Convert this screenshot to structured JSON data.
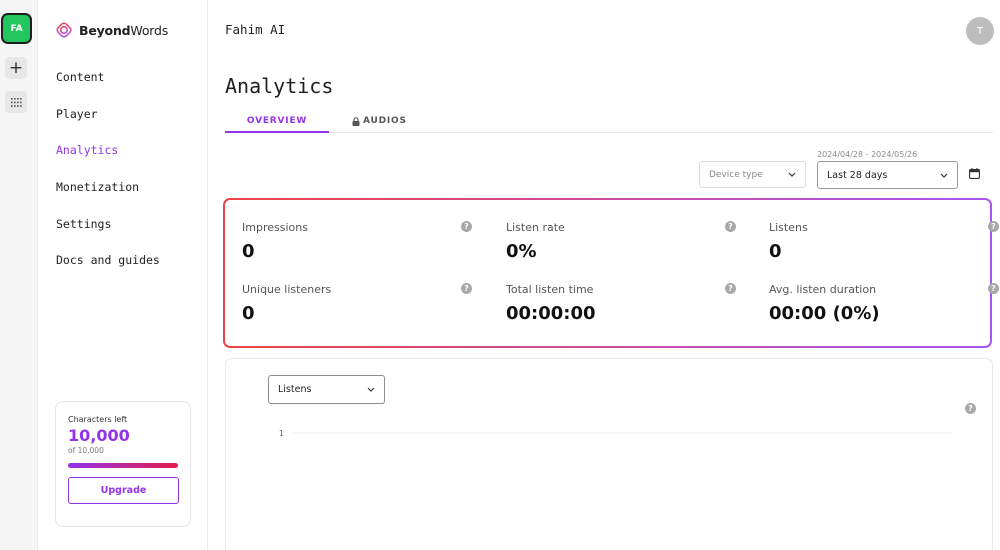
{
  "rail": {
    "workspace_badge": "FA",
    "icons": [
      "plus-icon",
      "grid-icon"
    ]
  },
  "sidebar": {
    "logo": {
      "bold": "Beyond",
      "regular": "Words",
      "icon": "beyondwords-logo-icon"
    },
    "nav": [
      {
        "label": "Content",
        "active": false
      },
      {
        "label": "Player",
        "active": false
      },
      {
        "label": "Analytics",
        "active": true
      },
      {
        "label": "Monetization",
        "active": false
      },
      {
        "label": "Settings",
        "active": false
      },
      {
        "label": "Docs and guides",
        "active": false
      }
    ],
    "credits": {
      "label": "Characters left",
      "value": "10,000",
      "of": "of 10,000",
      "remaining_fraction": 1.0,
      "upgrade_label": "Upgrade"
    }
  },
  "header": {
    "workspace_name": "Fahim AI",
    "avatar_initial": "T"
  },
  "page": {
    "title": "Analytics",
    "tabs": [
      {
        "label": "OVERVIEW",
        "active": true
      },
      {
        "label": "AUDIOS",
        "active": false,
        "icon": "lock-icon"
      }
    ]
  },
  "filters": {
    "date_range": "2024/04/28 - 2024/05/26",
    "device_placeholder": "Device type",
    "period": "Last 28 days",
    "calendar_icon": "calendar-icon"
  },
  "stats": [
    {
      "label": "Impressions",
      "value": "0"
    },
    {
      "label": "Listen rate",
      "value": "0%"
    },
    {
      "label": "Listens",
      "value": "0"
    },
    {
      "label": "Unique listeners",
      "value": "0"
    },
    {
      "label": "Total listen time",
      "value": "00:00:00"
    },
    {
      "label": "Avg. listen duration",
      "value": "00:00 (0%)"
    }
  ],
  "help_glyph": "?",
  "chart": {
    "metric": "Listens"
  },
  "chart_data": {
    "type": "line",
    "y_ticks": [
      1
    ],
    "ylim": [
      0,
      1
    ],
    "series": [],
    "grid": true
  },
  "colors": {
    "accent": "#9333ea",
    "gradient_start": "#ef4444",
    "gradient_end": "#a855f7",
    "badge": "#22c55e"
  }
}
